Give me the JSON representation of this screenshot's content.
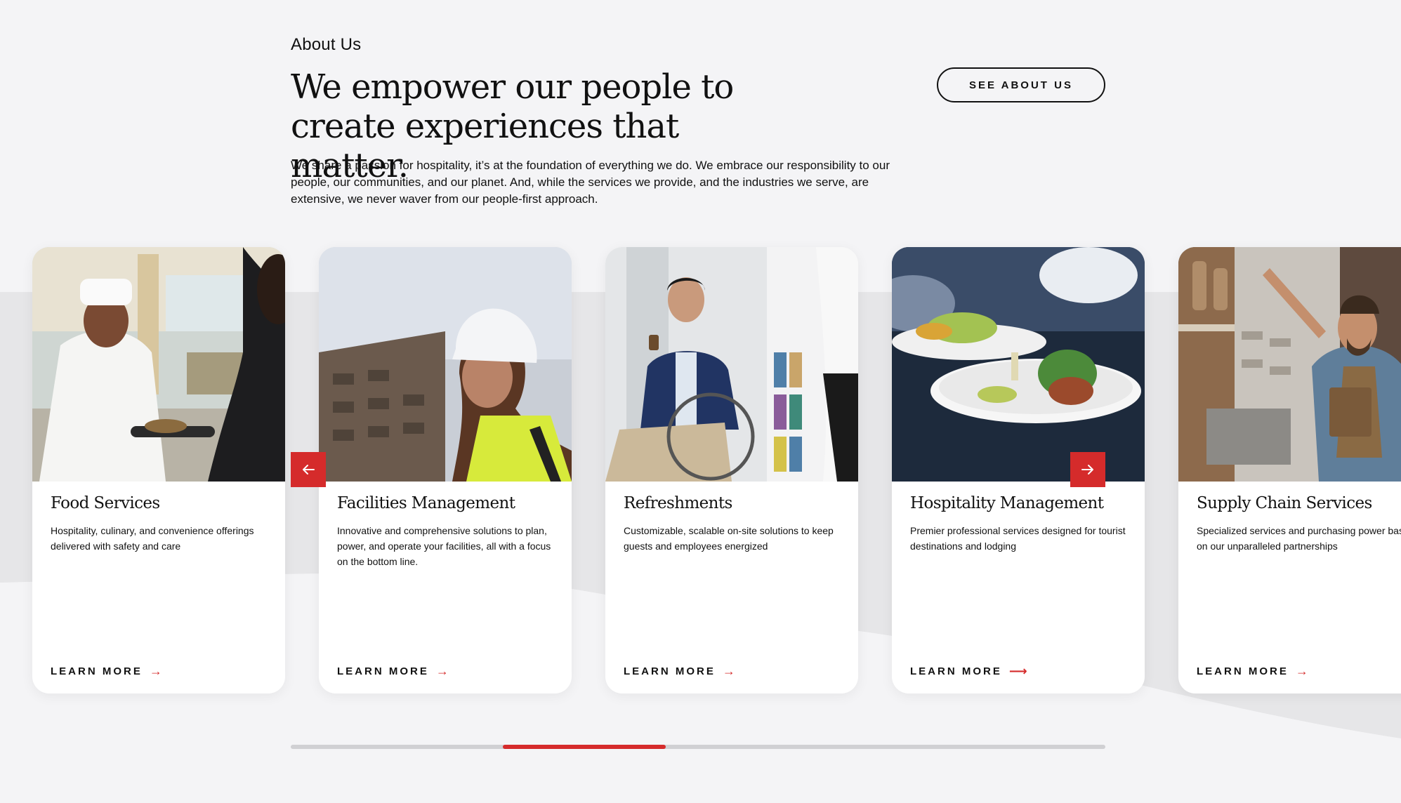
{
  "section": {
    "eyebrow": "About Us",
    "headline": "We empower our people to create experiences that matter.",
    "intro": "We share a passion for hospitality, it’s at the foundation of everything we do. We embrace our responsibility to our people, our communities, and our planet. And, while the services we provide, and the industries we serve, are extensive, we never waver from our people-first approach.",
    "cta_label": "SEE ABOUT US"
  },
  "cards": [
    {
      "title": "Food Services",
      "desc": "Hospitality, culinary, and convenience offerings delivered with safety and care",
      "link": "LEARN MORE",
      "image": "chef-serving-food-image"
    },
    {
      "title": "Facilities Management",
      "desc": "Innovative and comprehensive solutions to plan, power, and operate your facilities, all with a focus on the bottom line.",
      "link": "LEARN MORE",
      "image": "worker-hardhat-image"
    },
    {
      "title": "Refreshments",
      "desc": "Customizable, scalable on-site solutions to keep guests and employees energized",
      "link": "LEARN MORE",
      "image": "man-coffee-wheelchair-image"
    },
    {
      "title": "Hospitality Management",
      "desc": "Premier professional services designed for tourist destinations and lodging",
      "link": "LEARN MORE",
      "image": "plated-dishes-image"
    },
    {
      "title": "Supply Chain Services",
      "desc": "Specialized services and purchasing power based on our unparalleled partnerships",
      "link": "LEARN MORE",
      "image": "warehouse-clipboard-image"
    }
  ],
  "carousel": {
    "prev_icon": "arrow-left-icon",
    "next_icon": "arrow-right-icon",
    "progress": 0.2
  },
  "colors": {
    "accent": "#d52b2b",
    "background": "#f4f4f6",
    "band": "#e6e6e8"
  }
}
